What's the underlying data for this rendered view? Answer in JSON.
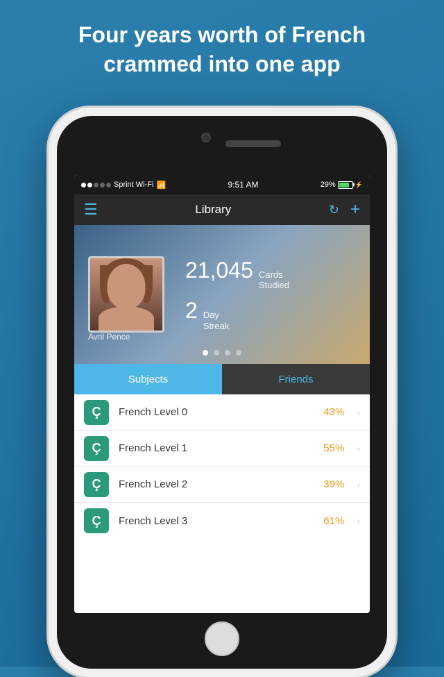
{
  "headline": {
    "line1": "Four years worth of French",
    "line2": "crammed into one app",
    "full": "Four years worth of French crammed into one app"
  },
  "status_bar": {
    "carrier": "Sprint Wi-Fi",
    "time": "9:51 AM",
    "battery": "29%",
    "signal_filled": 2,
    "signal_empty": 3
  },
  "navbar": {
    "title": "Library",
    "menu_label": "☰",
    "refresh_label": "↻",
    "add_label": "+"
  },
  "profile": {
    "name": "Avril Pence",
    "cards_studied_number": "21,045",
    "cards_studied_label": "Cards\nStudied",
    "day_streak_number": "2",
    "day_streak_label": "Day\nStreak"
  },
  "tabs": [
    {
      "label": "Subjects",
      "active": true
    },
    {
      "label": "Friends",
      "active": false
    }
  ],
  "subjects": [
    {
      "icon": "Ç",
      "name": "French Level 0",
      "percent": "43%",
      "chevron": "›"
    },
    {
      "icon": "Ç",
      "name": "French Level 1",
      "percent": "55%",
      "chevron": "›"
    },
    {
      "icon": "Ç",
      "name": "French Level 2",
      "percent": "39%",
      "chevron": "›"
    },
    {
      "icon": "Ç",
      "name": "French Level 3",
      "percent": "61%",
      "chevron": "›"
    }
  ],
  "pagination": {
    "total": 4,
    "active": 0
  }
}
